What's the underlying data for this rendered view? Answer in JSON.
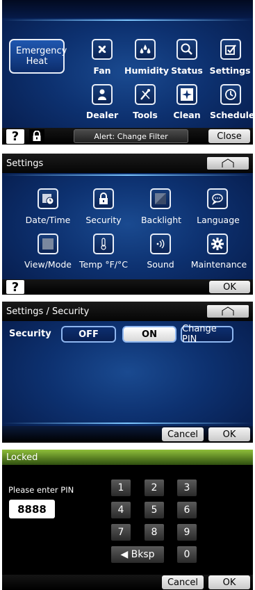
{
  "screen1": {
    "emergency_heat": "Emergency Heat",
    "icons_row1": [
      {
        "label": "Fan",
        "icon": "fan-icon"
      },
      {
        "label": "Humidity",
        "icon": "humidity-icon"
      },
      {
        "label": "Status",
        "icon": "magnifier-icon"
      },
      {
        "label": "Settings",
        "icon": "checkmark-icon"
      }
    ],
    "icons_row2": [
      {
        "label": "Dealer",
        "icon": "person-icon"
      },
      {
        "label": "Tools",
        "icon": "tools-icon"
      },
      {
        "label": "Clean",
        "icon": "sparkle-icon"
      },
      {
        "label": "Schedule",
        "icon": "clock-icon"
      }
    ],
    "help": "?",
    "alert": "Alert: Change Filter",
    "close": "Close"
  },
  "screen2": {
    "title": "Settings",
    "icons_row1": [
      {
        "label": "Date/Time",
        "icon": "calendar-clock-icon"
      },
      {
        "label": "Security",
        "icon": "lock-icon"
      },
      {
        "label": "Backlight",
        "icon": "backlight-icon"
      },
      {
        "label": "Language",
        "icon": "speech-bubble-icon"
      }
    ],
    "icons_row2": [
      {
        "label": "View/Mode",
        "icon": "square-icon"
      },
      {
        "label": "Temp °F/°C",
        "icon": "thermometer-icon"
      },
      {
        "label": "Sound",
        "icon": "sound-icon"
      },
      {
        "label": "Maintenance",
        "icon": "gear-icon"
      }
    ],
    "help": "?",
    "ok": "OK"
  },
  "screen3": {
    "title": "Settings / Security",
    "security_label": "Security",
    "off": "OFF",
    "on": "ON",
    "change_pin": "Change PIN",
    "cancel": "Cancel",
    "ok": "OK"
  },
  "screen4": {
    "title": "Locked",
    "prompt": "Please enter PIN",
    "pin_value": "8888",
    "keys": [
      "1",
      "2",
      "3",
      "4",
      "5",
      "6",
      "7",
      "8",
      "9"
    ],
    "backspace": "◀ Bksp",
    "zero": "0",
    "cancel": "Cancel",
    "ok": "OK"
  }
}
